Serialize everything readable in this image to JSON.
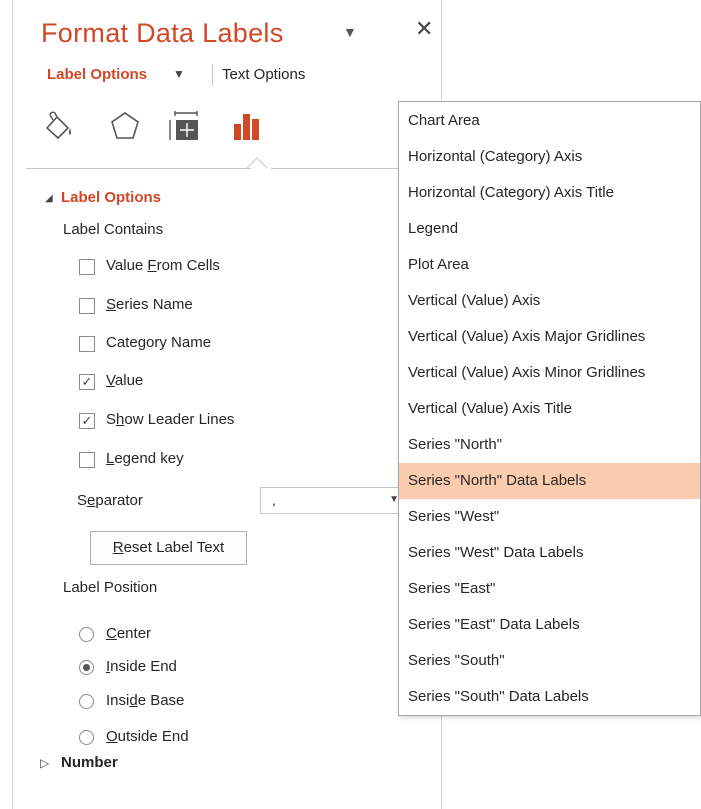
{
  "pane": {
    "title": "Format Data Labels",
    "close_glyph": "✕",
    "title_menu_glyph": "▼",
    "tabs": {
      "label_options": "Label Options",
      "label_options_chev": "▼",
      "text_options": "Text Options"
    },
    "icons": [
      "fill-line-icon",
      "effects-icon",
      "size-properties-icon",
      "label-options-chart-icon"
    ],
    "accent_color": "#d24726",
    "section": {
      "title": "Label Options",
      "label_contains": "Label Contains",
      "checkboxes": [
        {
          "pre": "Value ",
          "ul": "F",
          "post": "rom Cells",
          "checked": false
        },
        {
          "pre": "",
          "ul": "S",
          "post": "eries Name",
          "checked": false
        },
        {
          "pre": "Cate",
          "ul": "g",
          "post": "ory Name",
          "checked": false
        },
        {
          "pre": "",
          "ul": "V",
          "post": "alue",
          "checked": true
        },
        {
          "pre": "S",
          "ul": "h",
          "post": "ow Leader Lines",
          "checked": true
        },
        {
          "pre": "",
          "ul": "L",
          "post": "egend key",
          "checked": false
        }
      ],
      "separator": {
        "pre": "S",
        "ul": "e",
        "post": "parator",
        "value": ","
      },
      "reset_button": {
        "pre": "",
        "ul": "R",
        "post": "eset Label Text"
      },
      "label_position": "Label Position",
      "radios": [
        {
          "pre": "",
          "ul": "C",
          "post": "enter",
          "selected": false
        },
        {
          "pre": "",
          "ul": "I",
          "post": "nside End",
          "selected": true
        },
        {
          "pre": "Insi",
          "ul": "d",
          "post": "e Base",
          "selected": false
        },
        {
          "pre": "",
          "ul": "O",
          "post": "utside End",
          "selected": false
        }
      ]
    },
    "number_section": "Number"
  },
  "dropdown": {
    "items": [
      "Chart Area",
      "Horizontal (Category) Axis",
      "Horizontal (Category) Axis Title",
      "Legend",
      "Plot Area",
      "Vertical (Value) Axis",
      "Vertical (Value) Axis Major Gridlines",
      "Vertical (Value) Axis Minor Gridlines",
      "Vertical (Value) Axis Title",
      "Series \"North\"",
      "Series \"North\" Data Labels",
      "Series \"West\"",
      "Series \"West\" Data Labels",
      "Series \"East\"",
      "Series \"East\" Data Labels",
      "Series \"South\"",
      "Series \"South\" Data Labels"
    ],
    "selected_index": 10,
    "highlight_color": "#fbcbad"
  }
}
